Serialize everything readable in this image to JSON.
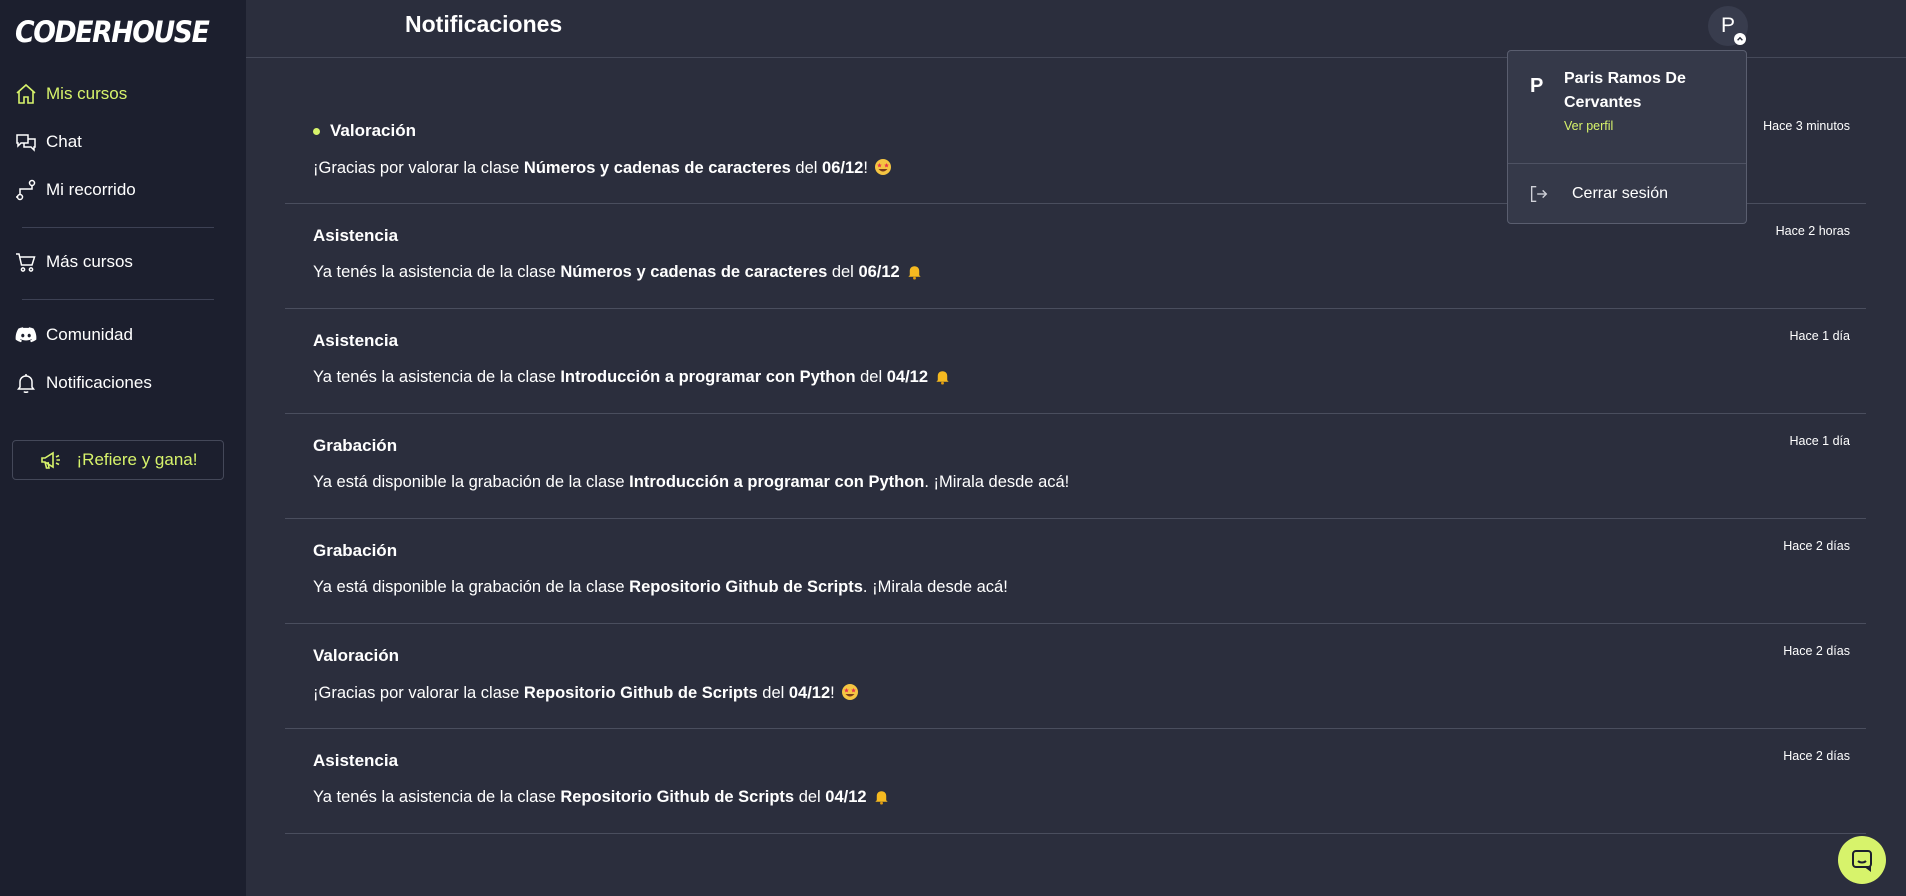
{
  "brand": {
    "logo_text": "CODERHOUSE",
    "accent_color": "#d7f36b"
  },
  "sidebar": {
    "items": [
      {
        "label": "Mis cursos",
        "icon": "home-icon",
        "active": true
      },
      {
        "label": "Chat",
        "icon": "chat-icon"
      },
      {
        "label": "Mi recorrido",
        "icon": "route-icon"
      },
      {
        "label": "Más cursos",
        "icon": "cart-icon"
      },
      {
        "label": "Comunidad",
        "icon": "discord-icon"
      },
      {
        "label": "Notificaciones",
        "icon": "bell-icon"
      }
    ],
    "refer_label": "¡Refiere y gana!",
    "refer_icon": "megaphone-icon"
  },
  "header": {
    "title": "Notificaciones",
    "avatar_initial": "P"
  },
  "profile_menu": {
    "initial": "P",
    "name": "Paris Ramos De Cervantes",
    "profile_link": "Ver perfil",
    "logout_label": "Cerrar sesión"
  },
  "notifications": [
    {
      "title": "Valoración",
      "unread": true,
      "time": "Hace 3 minutos",
      "parts": [
        {
          "t": "¡Gracias por valorar la clase "
        },
        {
          "t": "Números y cadenas de caracteres",
          "b": true
        },
        {
          "t": " del "
        },
        {
          "t": "06/12",
          "b": true
        },
        {
          "t": "!"
        }
      ],
      "emoji": "star-eyes"
    },
    {
      "title": "Asistencia",
      "time": "Hace 2 horas",
      "parts": [
        {
          "t": "Ya tenés la asistencia de la clase "
        },
        {
          "t": "Números y cadenas de caracteres",
          "b": true
        },
        {
          "t": " del "
        },
        {
          "t": "06/12",
          "b": true
        }
      ],
      "emoji": "bell"
    },
    {
      "title": "Asistencia",
      "time": "Hace 1 día",
      "parts": [
        {
          "t": "Ya tenés la asistencia de la clase "
        },
        {
          "t": "Introducción a programar con Python",
          "b": true
        },
        {
          "t": " del "
        },
        {
          "t": "04/12",
          "b": true
        }
      ],
      "emoji": "bell"
    },
    {
      "title": "Grabación",
      "time": "Hace 1 día",
      "parts": [
        {
          "t": "Ya está disponible la grabación de la clase "
        },
        {
          "t": "Introducción a programar con Python",
          "b": true
        },
        {
          "t": ". ¡Mirala desde acá!"
        }
      ]
    },
    {
      "title": "Grabación",
      "time": "Hace 2 días",
      "parts": [
        {
          "t": "Ya está disponible la grabación de la clase "
        },
        {
          "t": "Repositorio Github de Scripts",
          "b": true
        },
        {
          "t": ". ¡Mirala desde acá!"
        }
      ]
    },
    {
      "title": "Valoración",
      "time": "Hace 2 días",
      "parts": [
        {
          "t": "¡Gracias por valorar la clase "
        },
        {
          "t": "Repositorio Github de Scripts",
          "b": true
        },
        {
          "t": " del "
        },
        {
          "t": "04/12",
          "b": true
        },
        {
          "t": "!"
        }
      ],
      "emoji": "star-eyes"
    },
    {
      "title": "Asistencia",
      "time": "Hace 2 días",
      "parts": [
        {
          "t": "Ya tenés la asistencia de la clase "
        },
        {
          "t": "Repositorio Github de Scripts",
          "b": true
        },
        {
          "t": " del "
        },
        {
          "t": "04/12",
          "b": true
        }
      ],
      "emoji": "bell"
    }
  ],
  "chat_widget": {
    "icon": "chat-bubble-icon"
  }
}
